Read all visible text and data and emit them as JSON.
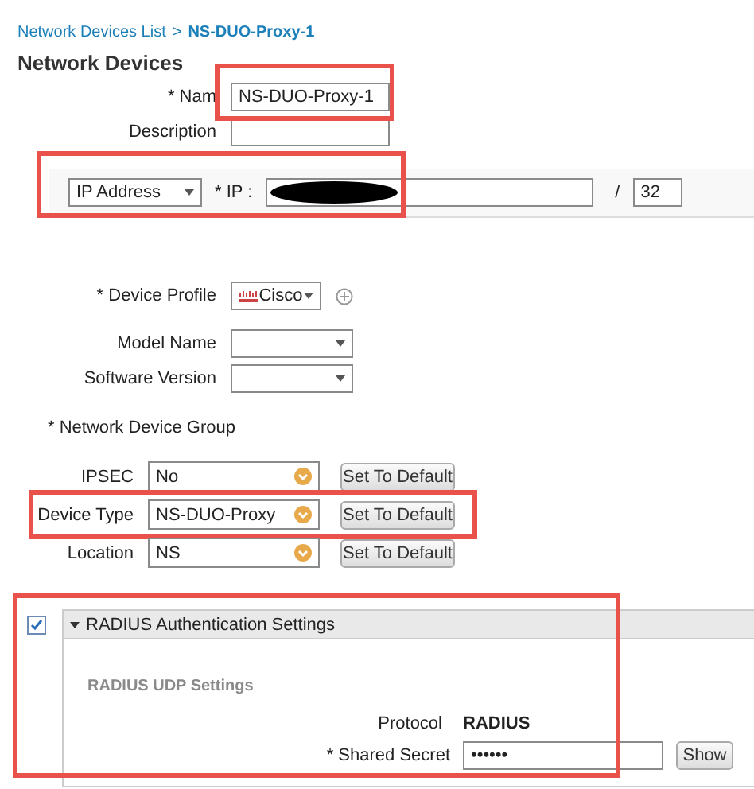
{
  "breadcrumb": {
    "parent": "Network Devices List",
    "separator": ">",
    "current": "NS-DUO-Proxy-1"
  },
  "heading": "Network Devices",
  "name": {
    "label": "* Nam",
    "value": "NS-DUO-Proxy-1",
    "highlighted": true
  },
  "description": {
    "label": "Description"
  },
  "ip": {
    "type": "IP Address",
    "label": "* IP :",
    "separator": "/",
    "mask": "32",
    "highlighted": true
  },
  "device_profile": {
    "label": "* Device Profile",
    "value": "Cisco"
  },
  "model_name": {
    "label": "Model Name"
  },
  "software_version": {
    "label": "Software Version"
  },
  "device_group": {
    "label": "* Network Device Group",
    "rows": [
      {
        "label": "IPSEC",
        "value": "No",
        "button": "Set To Default",
        "highlighted": false
      },
      {
        "label": "Device Type",
        "value": "NS-DUO-Proxy",
        "button": "Set To Default",
        "highlighted": true
      },
      {
        "label": "Location",
        "value": "NS",
        "button": "Set To Default",
        "highlighted": false
      }
    ]
  },
  "radius": {
    "checked": true,
    "expanded": true,
    "highlighted": true,
    "title": "RADIUS Authentication Settings",
    "subheading": "RADIUS UDP Settings",
    "protocol_label": "Protocol",
    "protocol": "RADIUS",
    "secret_label": "* Shared Secret",
    "secret": "••••••",
    "show_button": "Show"
  }
}
